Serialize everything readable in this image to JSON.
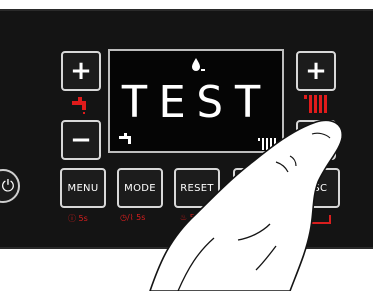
{
  "display": {
    "text": "TEST",
    "top_icon": "flame-icon",
    "left_icon": "tap-icon",
    "right_icon": "radiator-icon"
  },
  "buttons": {
    "plus": "+",
    "minus": "−",
    "menu": "MENU",
    "mode": "MODE",
    "reset": "RESET",
    "esc": "ESC",
    "menu_hint": "ⓘ 5s",
    "mode_hint": "5s",
    "reset_hint": "5s"
  },
  "colors": {
    "accent_red": "#d81e1e",
    "panel": "#141414",
    "display_bg": "#050505"
  }
}
